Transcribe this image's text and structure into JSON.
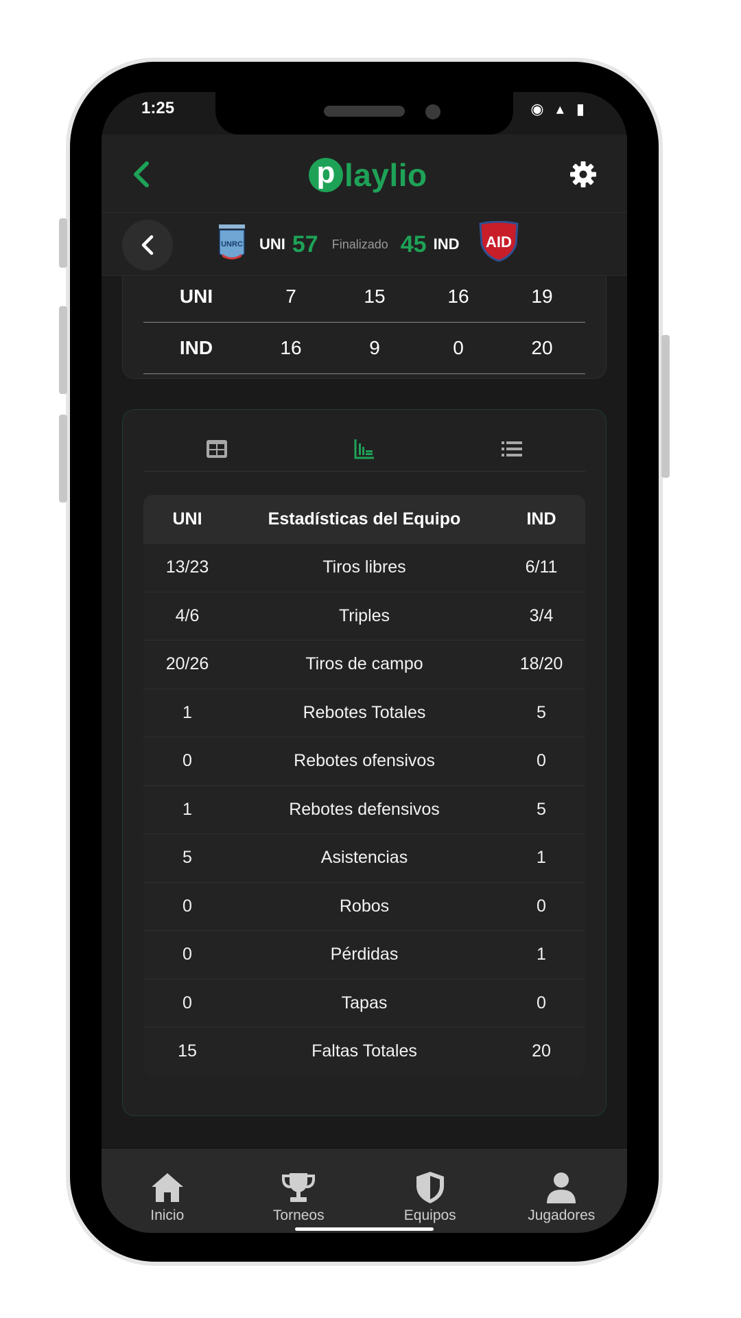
{
  "status_bar": {
    "time": "1:25",
    "icons": "◉ ▴ ▮"
  },
  "header": {
    "logo_letter": "p",
    "logo_rest": "laylio",
    "back_icon": "chevron-left-icon",
    "settings_icon": "gear-icon",
    "brand_color": "#1ea257"
  },
  "scoreboard": {
    "home_abbr": "UNI",
    "home_score": "57",
    "status": "Finalizado",
    "away_score": "45",
    "away_abbr": "IND",
    "home_logo_text": "UNRC",
    "away_logo_text": "AID"
  },
  "period_table": {
    "rows": [
      {
        "team": "UNI",
        "values": [
          "7",
          "15",
          "16",
          "19"
        ]
      },
      {
        "team": "IND",
        "values": [
          "16",
          "9",
          "0",
          "20"
        ]
      }
    ]
  },
  "view_tabs": [
    {
      "icon": "table-icon",
      "active": false
    },
    {
      "icon": "chart-icon",
      "active": true
    },
    {
      "icon": "list-icon",
      "active": false
    }
  ],
  "stats": {
    "header": {
      "left": "UNI",
      "mid": "Estadísticas del Equipo",
      "right": "IND"
    },
    "rows": [
      {
        "left": "13/23",
        "label": "Tiros libres",
        "right": "6/11"
      },
      {
        "left": "4/6",
        "label": "Triples",
        "right": "3/4"
      },
      {
        "left": "20/26",
        "label": "Tiros de campo",
        "right": "18/20"
      },
      {
        "left": "1",
        "label": "Rebotes Totales",
        "right": "5"
      },
      {
        "left": "0",
        "label": "Rebotes ofensivos",
        "right": "0"
      },
      {
        "left": "1",
        "label": "Rebotes defensivos",
        "right": "5"
      },
      {
        "left": "5",
        "label": "Asistencias",
        "right": "1"
      },
      {
        "left": "0",
        "label": "Robos",
        "right": "0"
      },
      {
        "left": "0",
        "label": "Pérdidas",
        "right": "1"
      },
      {
        "left": "0",
        "label": "Tapas",
        "right": "0"
      },
      {
        "left": "15",
        "label": "Faltas Totales",
        "right": "20"
      }
    ]
  },
  "bottom_nav": [
    {
      "label": "Inicio",
      "icon": "home-icon"
    },
    {
      "label": "Torneos",
      "icon": "trophy-icon"
    },
    {
      "label": "Equipos",
      "icon": "shield-icon",
      "active": true
    },
    {
      "label": "Jugadores",
      "icon": "user-icon"
    }
  ]
}
